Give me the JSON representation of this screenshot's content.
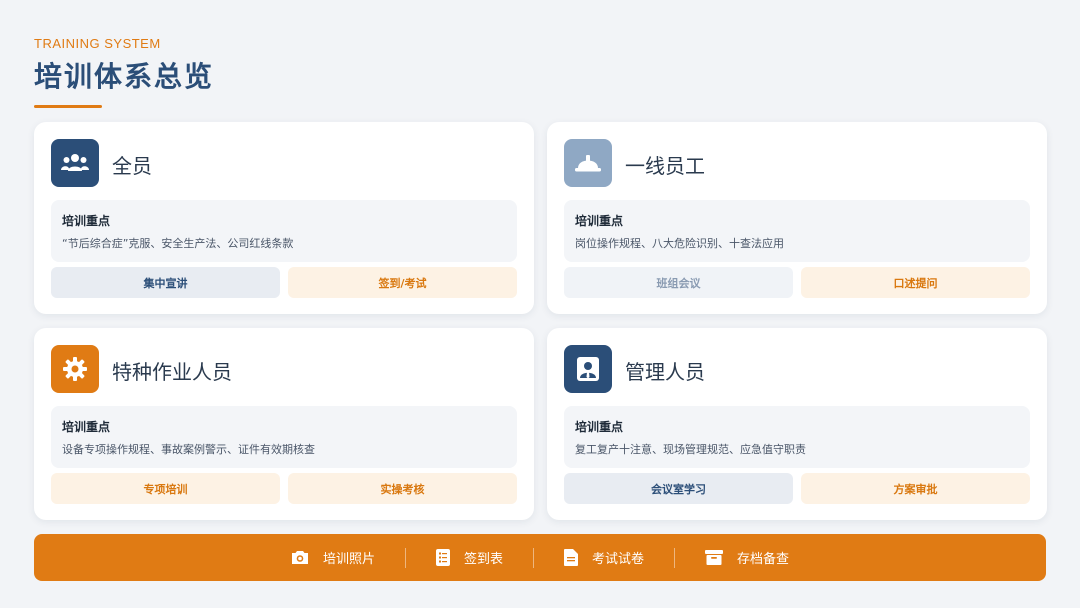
{
  "header": {
    "eyebrow": "TRAINING SYSTEM",
    "title": "培训体系总览"
  },
  "colors": {
    "accent": "#e07b14",
    "primary": "#2b4e78",
    "primary_light": "#8fa8c4"
  },
  "cards": [
    {
      "title": "全员",
      "icon": "group-icon",
      "focus_label": "培训重点",
      "focus_text": "“节后综合症”克服、安全生产法、公司红线条款",
      "buttons": [
        "集中宣讲",
        "签到/考试"
      ]
    },
    {
      "title": "一线员工",
      "icon": "hard-hat-icon",
      "focus_label": "培训重点",
      "focus_text": "岗位操作规程、八大危险识别、十查法应用",
      "buttons": [
        "班组会议",
        "口述提问"
      ]
    },
    {
      "title": "特种作业人员",
      "icon": "gear-icon",
      "focus_label": "培训重点",
      "focus_text": "设备专项操作规程、事故案例警示、证件有效期核查",
      "buttons": [
        "专项培训",
        "实操考核"
      ]
    },
    {
      "title": "管理人员",
      "icon": "manager-icon",
      "focus_label": "培训重点",
      "focus_text": "复工复产十注意、现场管理规范、应急值守职责",
      "buttons": [
        "会议室学习",
        "方案审批"
      ]
    }
  ],
  "footer": {
    "items": [
      {
        "label": "培训照片",
        "icon": "camera-icon"
      },
      {
        "label": "签到表",
        "icon": "checklist-icon"
      },
      {
        "label": "考试试卷",
        "icon": "document-icon"
      },
      {
        "label": "存档备查",
        "icon": "archive-icon"
      }
    ]
  }
}
